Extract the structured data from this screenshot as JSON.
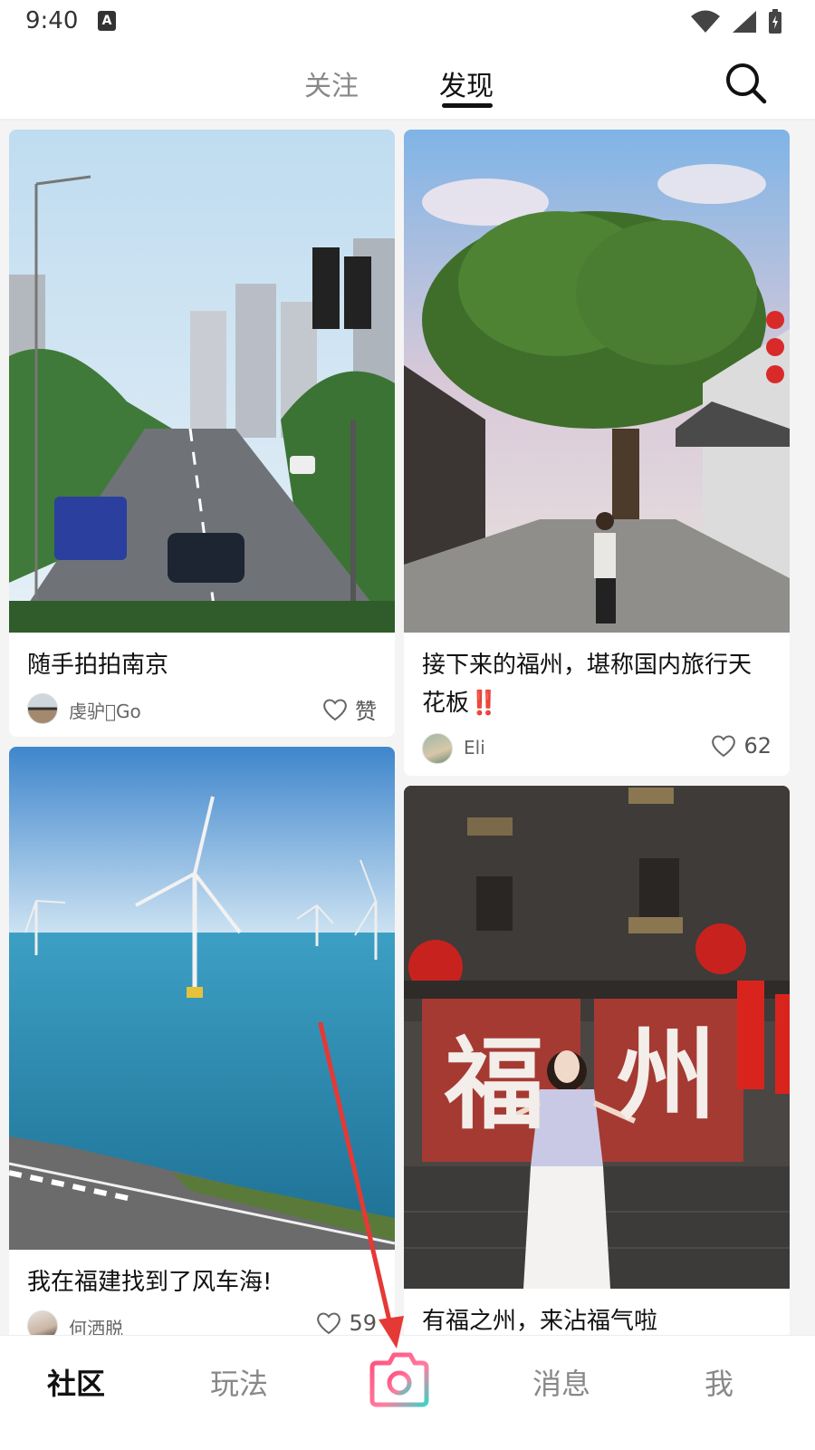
{
  "status_bar": {
    "time": "9:40",
    "badge": "A"
  },
  "header": {
    "tabs": [
      {
        "label": "关注",
        "active": false
      },
      {
        "label": "发现",
        "active": true
      }
    ]
  },
  "feed": {
    "cards": [
      {
        "title": "随手拍拍南京",
        "author": "虔驴\u0000Go",
        "likes": "赞"
      },
      {
        "title": "接下来的福州，堪称国内旅行天花板",
        "title_suffix": "‼️",
        "author": "Eli",
        "likes": "62"
      },
      {
        "title": "我在福建找到了风车海!",
        "author": "何洒脱",
        "likes": "59"
      },
      {
        "title": "有福之州，来沾福气啦"
      }
    ],
    "image_text": {
      "fu": "福",
      "zhou": "州"
    }
  },
  "bottom_nav": {
    "items": [
      {
        "label": "社区",
        "active": true
      },
      {
        "label": "玩法",
        "active": false
      },
      {
        "label": "消息",
        "active": false
      },
      {
        "label": "我",
        "active": false
      }
    ]
  },
  "colors": {
    "accent_red": "#e4232f",
    "camera_gradient_start": "#ff4d7a",
    "camera_gradient_end": "#3ed3c6",
    "annotation_arrow": "#e53935"
  }
}
